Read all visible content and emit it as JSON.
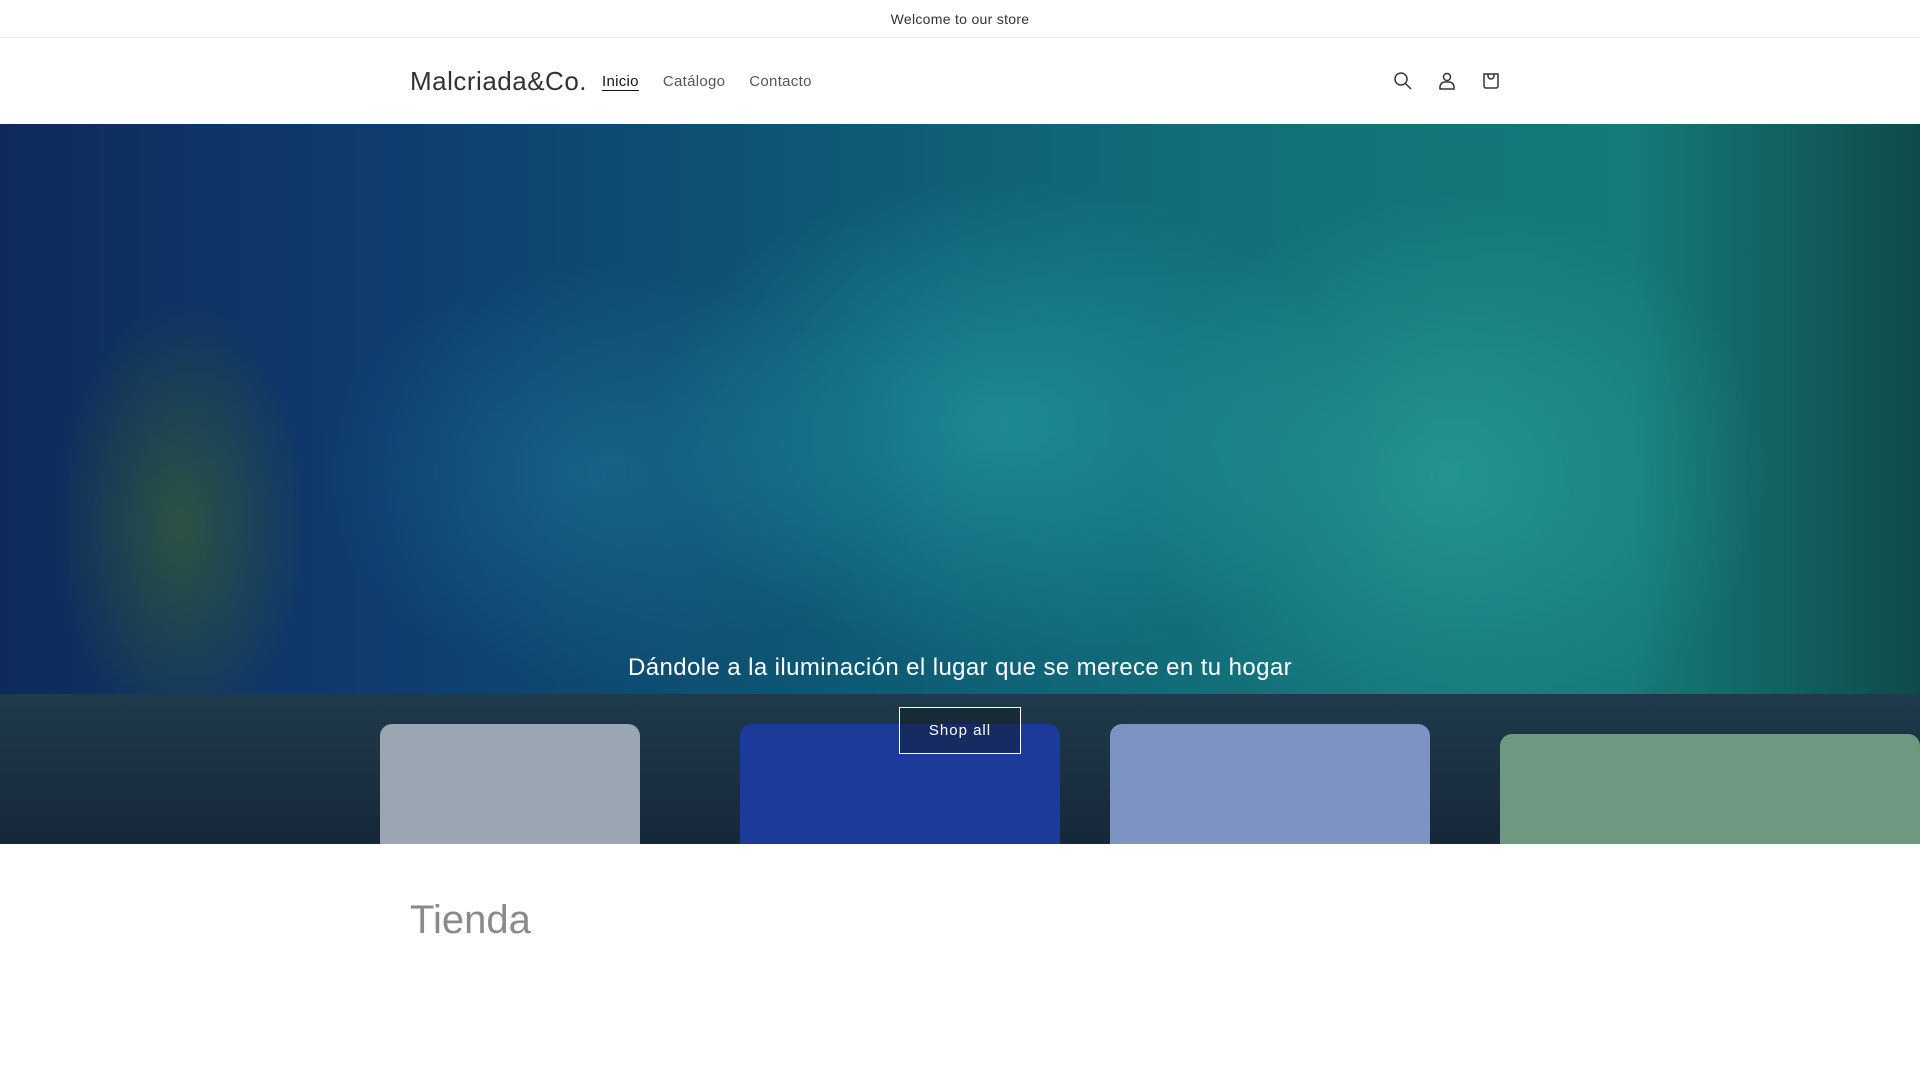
{
  "announcement": "Welcome to our store",
  "header": {
    "logo": "Malcriada&Co.",
    "nav": [
      {
        "label": "Inicio"
      },
      {
        "label": "Catálogo"
      },
      {
        "label": "Contacto"
      }
    ],
    "icons": [
      "search-icon",
      "account-icon",
      "cart-icon"
    ]
  },
  "hero": {
    "heading": "Dándole a la iluminación el lugar que se merece en tu hogar",
    "button": "Shop all"
  },
  "section": {
    "title": "Tienda"
  }
}
